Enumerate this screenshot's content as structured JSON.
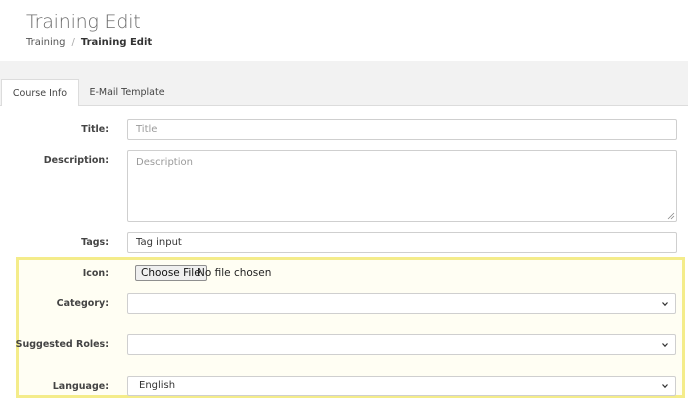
{
  "header": {
    "title": "Training Edit",
    "breadcrumb": {
      "root": "Training",
      "separator": "/",
      "current": "Training Edit"
    }
  },
  "tabs": [
    {
      "label": "Course Info",
      "active": true
    },
    {
      "label": "E-Mail Template",
      "active": false
    }
  ],
  "form": {
    "title": {
      "label": "Title:",
      "placeholder": "Title",
      "value": ""
    },
    "description": {
      "label": "Description:",
      "placeholder": "Description",
      "value": ""
    },
    "tags": {
      "label": "Tags:",
      "placeholder": "Tag input",
      "value": ""
    },
    "icon": {
      "label": "Icon:",
      "button_label": "Choose File",
      "status": "No file chosen"
    },
    "category": {
      "label": "Category:",
      "value": ""
    },
    "suggested_roles": {
      "label": "Suggested Roles:",
      "value": ""
    },
    "language": {
      "label": "Language:",
      "value": "English"
    }
  },
  "colors": {
    "highlight_border": "#f4ec8a",
    "band": "#f2f2f2",
    "border": "#cfcfcf"
  },
  "icons": [
    "chevron-down-icon",
    "resize-grip-icon"
  ]
}
